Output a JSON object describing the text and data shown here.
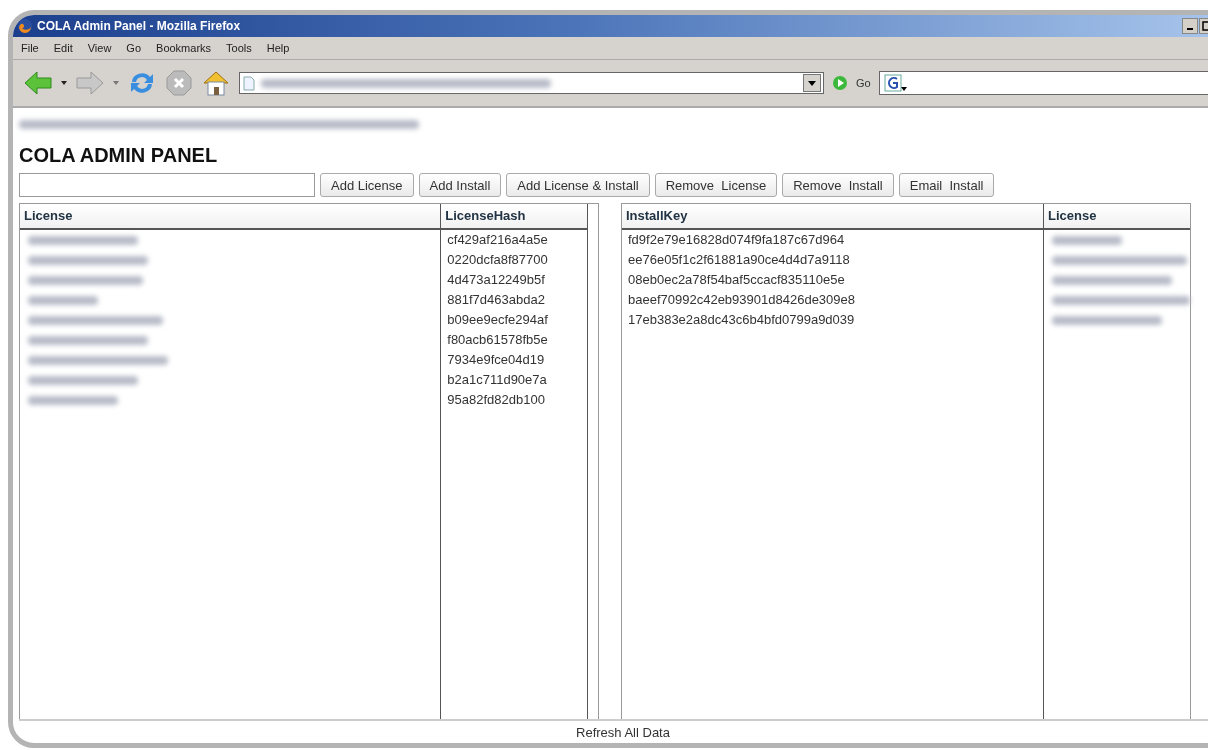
{
  "window": {
    "title": "COLA Admin Panel - Mozilla Firefox"
  },
  "menu": [
    "File",
    "Edit",
    "View",
    "Go",
    "Bookmarks",
    "Tools",
    "Help"
  ],
  "navbar": {
    "go_label": "Go"
  },
  "page": {
    "heading": "COLA ADMIN PANEL",
    "buttons": [
      "Add License",
      "Add Install",
      "Add License & Install",
      "Remove  License",
      "Remove  Install",
      "Email  Install"
    ],
    "licenses_table": {
      "columns": [
        "License",
        "LicenseHash"
      ],
      "rows": [
        {
          "hash": "cf429af216a4a5e"
        },
        {
          "hash": "0220dcfa8f87700"
        },
        {
          "hash": "4d473a12249b5f"
        },
        {
          "hash": "881f7d463abda2"
        },
        {
          "hash": "b09ee9ecfe294af"
        },
        {
          "hash": "f80acb61578fb5e"
        },
        {
          "hash": "7934e9fce04d19"
        },
        {
          "hash": "b2a1c711d90e7a"
        },
        {
          "hash": "95a82fd82db100"
        }
      ]
    },
    "installs_table": {
      "columns": [
        "InstallKey",
        "License"
      ],
      "rows": [
        {
          "key": "fd9f2e79e16828d074f9fa187c67d964"
        },
        {
          "key": "ee76e05f1c2f61881a90ce4d4d7a9118"
        },
        {
          "key": "08eb0ec2a78f54baf5ccacf835110e5e"
        },
        {
          "key": "baeef70992c42eb93901d8426de309e8"
        },
        {
          "key": "17eb383e2a8dc43c6b4bfd0799a9d039"
        }
      ]
    },
    "refresh_button": "Refresh All Data"
  }
}
